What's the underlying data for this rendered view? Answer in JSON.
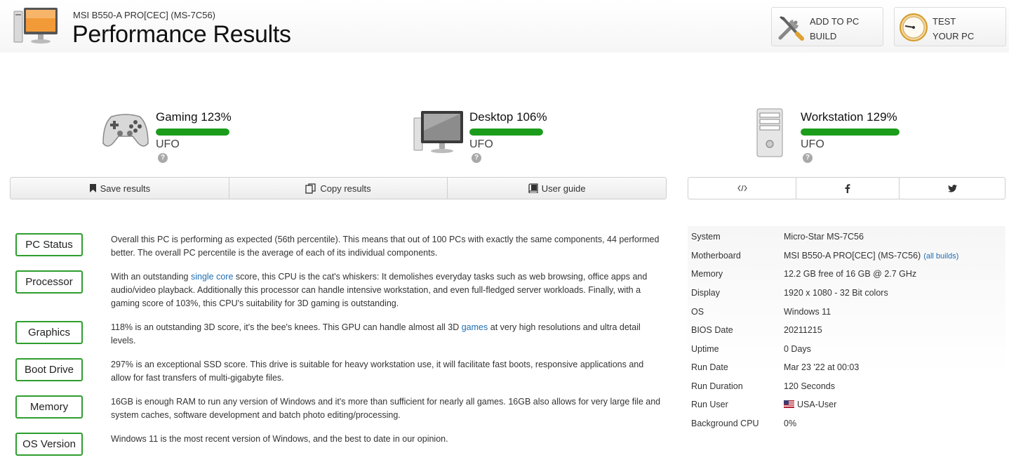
{
  "header": {
    "subtitle": "MSI B550-A PRO[CEC] (MS-7C56)",
    "title": "Performance Results",
    "add_button": {
      "line1": "ADD TO PC",
      "line2": "BUILD"
    },
    "test_button": {
      "line1": "TEST",
      "line2": "YOUR PC"
    }
  },
  "scores": [
    {
      "name": "Gaming 123%",
      "tier": "UFO",
      "percent": 123,
      "bar_fill_fraction": 1.0,
      "icon": "gamepad-icon"
    },
    {
      "name": "Desktop 106%",
      "tier": "UFO",
      "percent": 106,
      "bar_fill_fraction": 1.0,
      "icon": "monitor-icon"
    },
    {
      "name": "Workstation 129%",
      "tier": "UFO",
      "percent": 129,
      "bar_fill_fraction": 1.0,
      "icon": "tower-icon"
    }
  ],
  "actions": {
    "save": "Save results",
    "copy": "Copy results",
    "guide": "User guide"
  },
  "share": [
    "embed-code-icon",
    "facebook-icon",
    "twitter-icon"
  ],
  "summary": [
    {
      "label": "PC Status",
      "text": "Overall this PC is performing as expected (56th percentile). This means that out of 100 PCs with exactly the same components, 44 performed better. The overall PC percentile is the average of each of its individual components."
    },
    {
      "label": "Processor",
      "pre": "With an outstanding ",
      "link": "single core",
      "post": " score, this CPU is the cat's whiskers: It demolishes everyday tasks such as web browsing, office apps and audio/video playback. Additionally this processor can handle intensive workstation, and even full-fledged server workloads. Finally, with a gaming score of 103%, this CPU's suitability for 3D gaming is outstanding."
    },
    {
      "label": "Graphics",
      "pre": "118% is an outstanding 3D score, it's the bee's knees. This GPU can handle almost all 3D ",
      "link": "games",
      "post": " at very high resolutions and ultra detail levels."
    },
    {
      "label": "Boot Drive",
      "text": "297% is an exceptional SSD score. This drive is suitable for heavy workstation use, it will facilitate fast boots, responsive applications and allow for fast transfers of multi-gigabyte files."
    },
    {
      "label": "Memory",
      "text": "16GB is enough RAM to run any version of Windows and it's more than sufficient for nearly all games. 16GB also allows for very large file and system caches, software development and batch photo editing/processing."
    },
    {
      "label": "OS Version",
      "text": "Windows 11 is the most recent version of Windows, and the best to date in our opinion."
    }
  ],
  "system": {
    "rows": [
      {
        "key": "System",
        "value": "Micro-Star MS-7C56"
      },
      {
        "key": "Motherboard",
        "value": "MSI B550-A PRO[CEC] (MS-7C56)",
        "link": "(all builds)"
      },
      {
        "key": "Memory",
        "value": "12.2 GB free of 16 GB @ 2.7 GHz"
      },
      {
        "key": "Display",
        "value": "1920 x 1080 - 32 Bit colors"
      },
      {
        "key": "OS",
        "value": "Windows 11"
      },
      {
        "key": "BIOS Date",
        "value": "20211215"
      },
      {
        "key": "Uptime",
        "value": "0 Days"
      },
      {
        "key": "Run Date",
        "value": "Mar 23 '22 at 00:03"
      },
      {
        "key": "Run Duration",
        "value": "120 Seconds"
      },
      {
        "key": "Run User",
        "value": "USA-User",
        "flag": "us-flag-icon"
      },
      {
        "key": "Background CPU",
        "value": "0%"
      }
    ]
  },
  "colors": {
    "score_bar": "#1b9c1b",
    "badge_border": "#2e9e2e",
    "link": "#1f6fb2"
  }
}
